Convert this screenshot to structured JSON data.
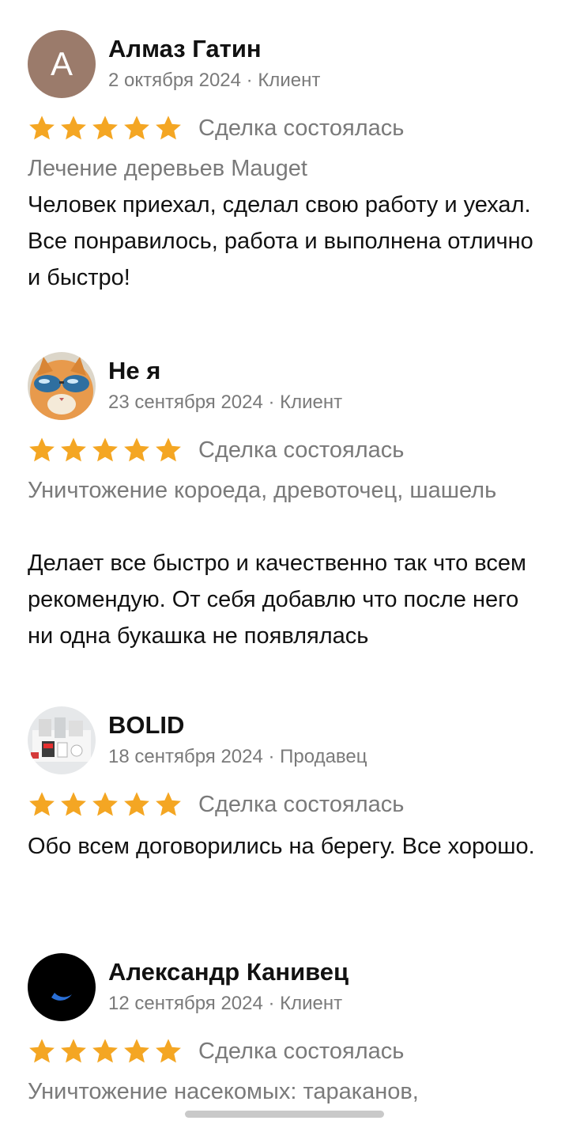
{
  "deal_status_label": "Сделка состоялась",
  "star_color": "#f4a623",
  "reviews": [
    {
      "name": "Алмаз Гатин",
      "avatar_letter": "А",
      "meta": "2 октября 2024 · Клиент",
      "rating": 5,
      "service": "Лечение деревьев Mauget",
      "text": "Человек приехал, сделал свою работу  и уехал. Все понравилось, работа и выполнена отлично и быстро!"
    },
    {
      "name": "Не я",
      "avatar_icon": "cat-sunglasses-avatar",
      "meta": "23 сентября 2024 · Клиент",
      "rating": 5,
      "service": "Уничтожение короеда, древоточец, шашель",
      "text": "Делает все быстро и качественно так что всем рекомендую. От себя добавлю что после него ни одна букашка не появлялась"
    },
    {
      "name": "BOLID",
      "avatar_icon": "security-devices-avatar",
      "meta": "18 сентября 2024 · Продавец",
      "rating": 5,
      "text": "Обо всем договорились на берегу. Все хорошо."
    },
    {
      "name": "Александр Канивец",
      "avatar_icon": "dark-moon-avatar",
      "meta": "12 сентября 2024 · Клиент",
      "rating": 5,
      "service": "Уничтожение насекомых: тараканов,"
    }
  ]
}
